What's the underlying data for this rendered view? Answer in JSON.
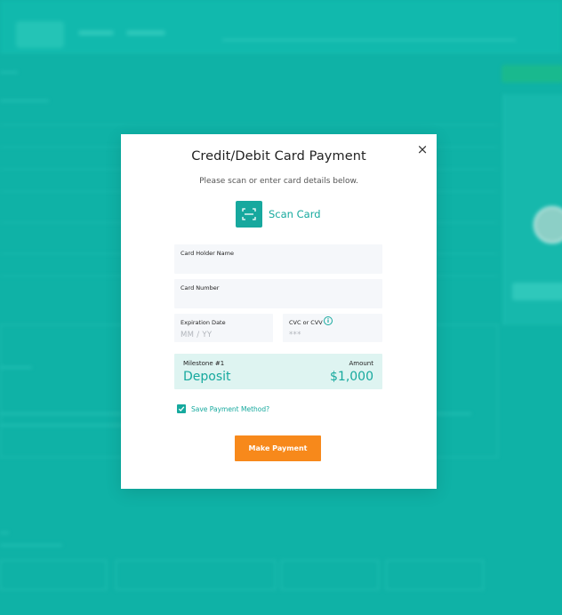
{
  "modal": {
    "title": "Credit/Debit Card Payment",
    "subtitle": "Please scan or enter card details below.",
    "close_icon": "×",
    "scan_button_label": "Scan Card",
    "fields": {
      "card_holder_name": {
        "label": "Card Holder Name",
        "value": ""
      },
      "card_number": {
        "label": "Card Number",
        "value": ""
      },
      "expiration_date": {
        "label": "Expiration Date",
        "placeholder": "MM / YY"
      },
      "cvc": {
        "label": "CVC or CVV",
        "placeholder": "***"
      }
    },
    "milestone": {
      "label": "Milestone #1",
      "amount_label": "Amount",
      "name": "Deposit",
      "amount": "$1,000"
    },
    "save_payment": {
      "label": "Save Payment Method?",
      "checked": true
    },
    "submit_label": "Make Payment"
  },
  "icons": [
    "close-icon",
    "scan-icon",
    "info-icon",
    "checkmark-icon"
  ],
  "colors": {
    "backdrop": "#0fb2a6",
    "accent_teal": "#16a99e",
    "button_orange": "#f7891b",
    "milestone_bg": "#def4f1",
    "field_bg": "#f5f7fa"
  }
}
